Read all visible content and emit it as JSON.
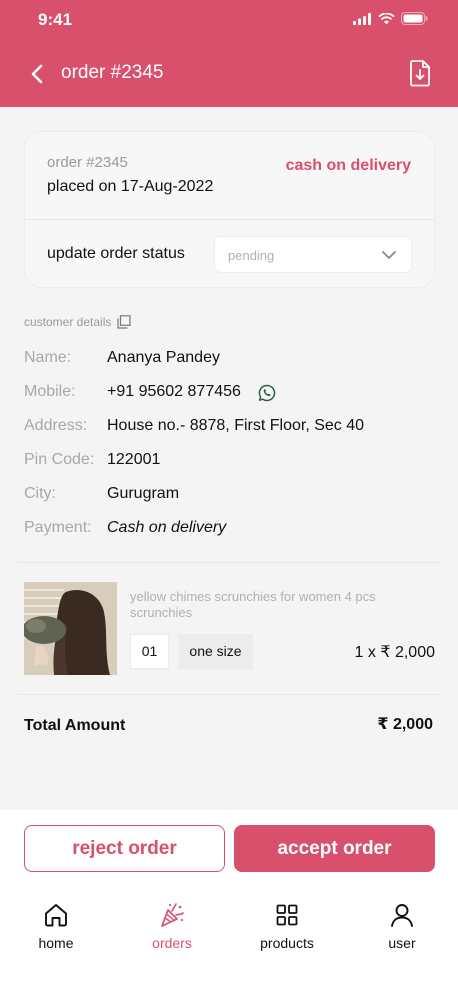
{
  "status_bar": {
    "time": "9:41"
  },
  "header": {
    "title": "order #2345"
  },
  "order": {
    "id": "order #2345",
    "placed_on": "placed on 17-Aug-2022",
    "payment_method": "cash on delivery",
    "status_label": "update order status",
    "status_value": "pending"
  },
  "customer": {
    "section_title": "customer details",
    "rows": [
      {
        "label": "Name:",
        "value": "Ananya Pandey"
      },
      {
        "label": "Mobile:",
        "value": "+91 95602 877456"
      },
      {
        "label": "Address:",
        "value": "House no.- 8878, First Floor, Sec 40"
      },
      {
        "label": "Pin Code:",
        "value": "122001"
      },
      {
        "label": "City:",
        "value": "Gurugram"
      },
      {
        "label": "Payment:",
        "value": "Cash on delivery"
      }
    ]
  },
  "product": {
    "name": "yellow chimes scrunchies for women 4 pcs scrunchies",
    "quantity": "01",
    "size": "one size",
    "line_price": "1 x ₹ 2,000"
  },
  "total": {
    "label": "Total Amount",
    "value": "₹ 2,000"
  },
  "actions": {
    "reject_label": "reject order",
    "accept_label": "accept order"
  },
  "nav": [
    {
      "label": "home",
      "icon": "home-icon"
    },
    {
      "label": "orders",
      "icon": "party-popper-icon",
      "active": true
    },
    {
      "label": "products",
      "icon": "grid-icon"
    },
    {
      "label": "user",
      "icon": "user-icon"
    }
  ],
  "colors": {
    "accent": "#d9506d",
    "background": "#f4f4f4"
  }
}
